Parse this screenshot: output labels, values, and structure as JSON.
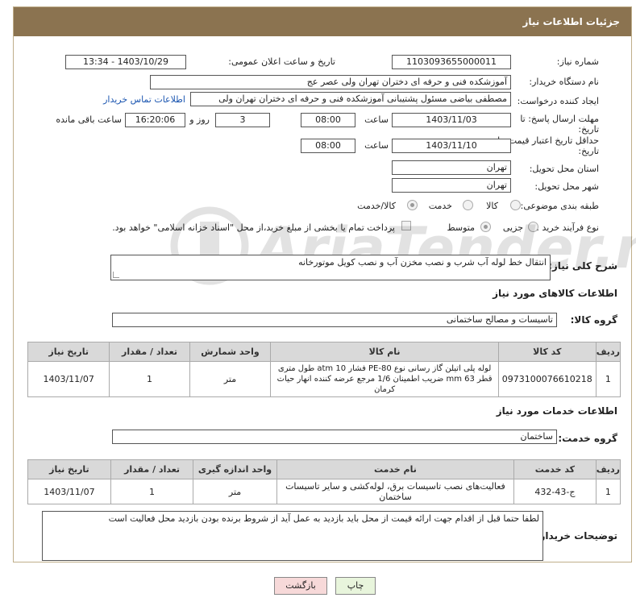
{
  "header": {
    "title": "جزئیات اطلاعات نیاز"
  },
  "fields": {
    "need_number_label": "شماره نیاز:",
    "need_number": "1103093655000011",
    "announce_label": "تاریخ و ساعت اعلان عمومی:",
    "announce_value": "1403/10/29 - 13:34",
    "buyer_org_label": "نام دستگاه خریدار:",
    "buyer_org": "آموزشکده فنی و حرفه ای دختران تهران ولی عصر عج",
    "creator_label": "ایجاد کننده درخواست:",
    "creator": "مصطفی بیاضی مسئول پشتیبانی آموزشکده فنی و حرفه ای دختران تهران ولی",
    "contact_link": "اطلاعات تماس خریدار",
    "reply_deadline_label": "مهلت ارسال پاسخ: تا",
    "reply_deadline_label2": "تاریخ:",
    "reply_date": "1403/11/03",
    "time_label": "ساعت",
    "reply_time": "08:00",
    "days_value": "3",
    "days_label": "روز و",
    "remaining_time": "16:20:06",
    "remaining_label": "ساعت باقی مانده",
    "validity_label": "حداقل تاریخ اعتبار قیمت: تا",
    "validity_label2": "تاریخ:",
    "validity_date": "1403/11/10",
    "validity_time_label": "ساعت",
    "validity_time": "08:00",
    "province_label": "استان محل تحویل:",
    "province": "تهران",
    "city_label": "شهر محل تحویل:",
    "city": "تهران",
    "category_label": "طبقه بندی موضوعی:",
    "category_options": [
      "کالا",
      "خدمت",
      "کالا/خدمت"
    ],
    "process_label": "نوع فرآیند خرید :",
    "process_options": [
      "جزیی",
      "متوسط"
    ],
    "process_note": "پرداخت تمام یا بخشی از مبلغ خرید،از محل \"اسناد خزانه اسلامی\" خواهد بود."
  },
  "description": {
    "label": "شرح کلی نیاز:",
    "value": "انتقال خط لوله آب شرب و نصب مخزن آب و نصب کویل موتورخانه"
  },
  "goods": {
    "section_title": "اطلاعات کالاهای مورد نیاز",
    "group_label": "گروه کالا:",
    "group_value": "تاسیسات و مصالح ساختمانی",
    "columns": [
      "ردیف",
      "کد کالا",
      "نام کالا",
      "واحد شمارش",
      "تعداد / مقدار",
      "تاریخ نیاز"
    ],
    "rows": [
      {
        "row": "1",
        "code": "0973100076610218",
        "name": "لوله پلی اتیلن گاز رسانی نوع PE-80 فشار 10 atm طول متری قطر 63 mm ضریب اطمینان 1/6 مرجع عرضه کننده انهار حیات کرمان",
        "unit": "متر",
        "qty": "1",
        "date": "1403/11/07"
      }
    ]
  },
  "services": {
    "section_title": "اطلاعات خدمات مورد نیاز",
    "group_label": "گروه خدمت:",
    "group_value": "ساختمان",
    "columns": [
      "ردیف",
      "کد خدمت",
      "نام خدمت",
      "واحد اندازه گیری",
      "تعداد / مقدار",
      "تاریخ نیاز"
    ],
    "rows": [
      {
        "row": "1",
        "code": "ج-43-432",
        "name": "فعالیت‌های نصب تاسیسات برق، لوله‌کشی و سایر تاسیسات ساختمان",
        "unit": "متر",
        "qty": "1",
        "date": "1403/11/07"
      }
    ]
  },
  "buyer_notes": {
    "label": "توضیحات خریدار:",
    "value": "لطفا حتما قبل از اقدام جهت ارائه قیمت از محل باید بازدید به عمل آید از شروط برنده بودن بازدید محل فعالیت است"
  },
  "buttons": {
    "print": "چاپ",
    "back": "بازگشت"
  },
  "colors": {
    "header_bg": "#8b7350",
    "back_button_bg": "#f7d9d9",
    "print_button_bg": "#e8f5dc"
  }
}
